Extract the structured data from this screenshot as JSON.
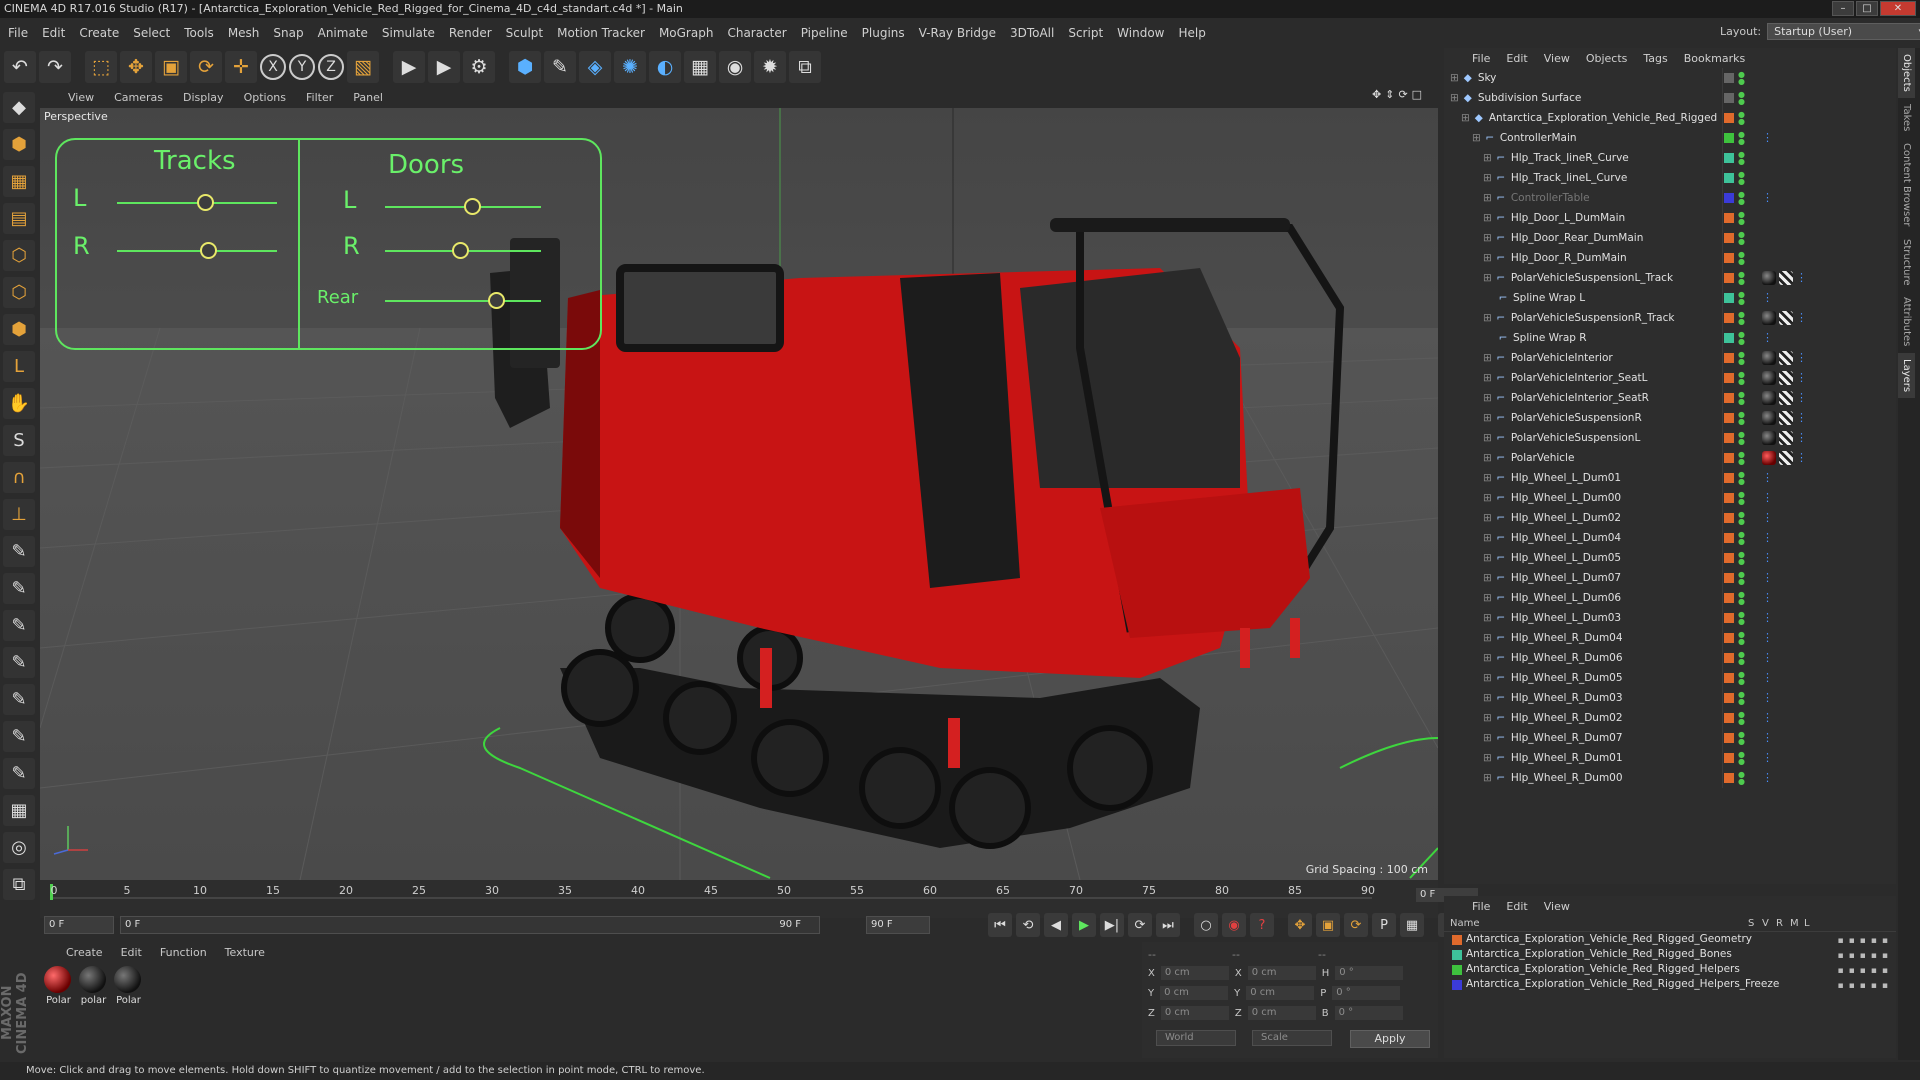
{
  "window": {
    "title": "CINEMA 4D R17.016 Studio (R17) - [Antarctica_Exploration_Vehicle_Red_Rigged_for_Cinema_4D_c4d_standart.c4d *] - Main"
  },
  "menubar": {
    "items": [
      "File",
      "Edit",
      "Create",
      "Select",
      "Tools",
      "Mesh",
      "Snap",
      "Animate",
      "Simulate",
      "Render",
      "Sculpt",
      "Motion Tracker",
      "MoGraph",
      "Character",
      "Pipeline",
      "Plugins",
      "V-Ray Bridge",
      "3DToAll",
      "Script",
      "Window",
      "Help"
    ],
    "layout_label": "Layout:",
    "layout_value": "Startup (User)"
  },
  "toolbar": {
    "icons": [
      "undo-icon",
      "redo-icon",
      "live-selection-icon",
      "move-icon",
      "scale-icon",
      "rotate-icon",
      "world-axis-icon",
      "x-axis-icon",
      "y-axis-icon",
      "z-axis-icon",
      "coordinate-system-icon",
      "render-view-icon",
      "render-picture-viewer-icon",
      "render-settings-icon",
      "cube-icon",
      "pen-icon",
      "subdivision-icon",
      "array-icon",
      "deformer-icon",
      "floor-icon",
      "camera-icon",
      "light-icon",
      "python-icon"
    ],
    "axis_labels": [
      "X",
      "Y",
      "Z"
    ]
  },
  "viewport": {
    "menu": [
      "View",
      "Cameras",
      "Display",
      "Options",
      "Filter",
      "Panel"
    ],
    "label": "Perspective",
    "grid_spacing": "Grid Spacing : 100 cm",
    "hud": {
      "tracks_title": "Tracks",
      "doors_title": "Doors",
      "label_l": "L",
      "label_r": "R",
      "label_rear": "Rear"
    }
  },
  "timeline": {
    "ticks": [
      "0",
      "5",
      "10",
      "15",
      "20",
      "25",
      "30",
      "35",
      "40",
      "45",
      "50",
      "55",
      "60",
      "65",
      "70",
      "75",
      "80",
      "85",
      "90"
    ],
    "current_frame": "0 F"
  },
  "playback": {
    "start": "0 F",
    "range_start": "0 F",
    "range_end": "90 F",
    "end": "90 F"
  },
  "material_manager": {
    "menu": [
      "Create",
      "Edit",
      "Function",
      "Texture"
    ],
    "materials": [
      {
        "label": "Polar",
        "style": "red"
      },
      {
        "label": "polar",
        "style": "dark"
      },
      {
        "label": "Polar",
        "style": "dark"
      }
    ]
  },
  "coordinates": {
    "header_left": "--",
    "header_mid": "--",
    "header_right": "--",
    "rows": [
      {
        "a": "X",
        "av": "0 cm",
        "b": "X",
        "bv": "0 cm",
        "c": "H",
        "cv": "0 °"
      },
      {
        "a": "Y",
        "av": "0 cm",
        "b": "Y",
        "bv": "0 cm",
        "c": "P",
        "cv": "0 °"
      },
      {
        "a": "Z",
        "av": "0 cm",
        "b": "Z",
        "bv": "0 cm",
        "c": "B",
        "cv": "0 °"
      }
    ],
    "mode_world": "World",
    "mode_scale": "Scale",
    "apply": "Apply"
  },
  "maxon_logo": "MAXON CINEMA 4D",
  "status": "Move: Click and drag to move elements. Hold down SHIFT to quantize movement / add to the selection in point mode, CTRL to remove.",
  "object_manager": {
    "menu": [
      "File",
      "Edit",
      "View",
      "Objects",
      "Tags",
      "Bookmarks"
    ],
    "objects": [
      {
        "name": "Sky",
        "indent": 0,
        "flag": "#666666",
        "tags": []
      },
      {
        "name": "Subdivision Surface",
        "indent": 0,
        "flag": "#666666",
        "tags": []
      },
      {
        "name": "Antarctica_Exploration_Vehicle_Red_Rigged",
        "indent": 1,
        "flag": "#e06a2c",
        "tags": []
      },
      {
        "name": "ControllerMain",
        "indent": 2,
        "flag": "#3ec23e",
        "tags": [
          "ik"
        ]
      },
      {
        "name": "Hlp_Track_lineR_Curve",
        "indent": 3,
        "flag": "#3ec29a",
        "tags": []
      },
      {
        "name": "Hlp_Track_lineL_Curve",
        "indent": 3,
        "flag": "#3ec29a",
        "tags": []
      },
      {
        "name": "ControllerTable",
        "indent": 3,
        "flag": "#3b3bd8",
        "tags": [
          "ik"
        ],
        "dim": true
      },
      {
        "name": "Hlp_Door_L_DumMain",
        "indent": 3,
        "flag": "#e06a2c",
        "tags": []
      },
      {
        "name": "Hlp_Door_Rear_DumMain",
        "indent": 3,
        "flag": "#e06a2c",
        "tags": []
      },
      {
        "name": "Hlp_Door_R_DumMain",
        "indent": 3,
        "flag": "#e06a2c",
        "tags": []
      },
      {
        "name": "PolarVehicleSuspensionL_Track",
        "indent": 3,
        "flag": "#e06a2c",
        "tags": [
          "dark",
          "chk",
          "ik"
        ]
      },
      {
        "name": "Spline Wrap L",
        "indent": 4,
        "flag": "#3ec29a",
        "tags": [
          "ik"
        ]
      },
      {
        "name": "PolarVehicleSuspensionR_Track",
        "indent": 3,
        "flag": "#e06a2c",
        "tags": [
          "dark",
          "chk",
          "ik"
        ]
      },
      {
        "name": "Spline Wrap R",
        "indent": 4,
        "flag": "#3ec29a",
        "tags": [
          "ik"
        ]
      },
      {
        "name": "PolarVehicleInterior",
        "indent": 3,
        "flag": "#e06a2c",
        "tags": [
          "dark",
          "chk",
          "ik"
        ]
      },
      {
        "name": "PolarVehicleInterior_SeatL",
        "indent": 3,
        "flag": "#e06a2c",
        "tags": [
          "dark",
          "chk",
          "ik"
        ]
      },
      {
        "name": "PolarVehicleInterior_SeatR",
        "indent": 3,
        "flag": "#e06a2c",
        "tags": [
          "dark",
          "chk",
          "ik"
        ]
      },
      {
        "name": "PolarVehicleSuspensionR",
        "indent": 3,
        "flag": "#e06a2c",
        "tags": [
          "dark",
          "chk",
          "ik"
        ]
      },
      {
        "name": "PolarVehicleSuspensionL",
        "indent": 3,
        "flag": "#e06a2c",
        "tags": [
          "dark",
          "chk",
          "ik"
        ]
      },
      {
        "name": "PolarVehicle",
        "indent": 3,
        "flag": "#e06a2c",
        "tags": [
          "redball",
          "chk",
          "ik"
        ]
      },
      {
        "name": "Hlp_Wheel_L_Dum01",
        "indent": 3,
        "flag": "#e06a2c",
        "tags": [
          "ik"
        ]
      },
      {
        "name": "Hlp_Wheel_L_Dum00",
        "indent": 3,
        "flag": "#e06a2c",
        "tags": [
          "ik"
        ]
      },
      {
        "name": "Hlp_Wheel_L_Dum02",
        "indent": 3,
        "flag": "#e06a2c",
        "tags": [
          "ik"
        ]
      },
      {
        "name": "Hlp_Wheel_L_Dum04",
        "indent": 3,
        "flag": "#e06a2c",
        "tags": [
          "ik"
        ]
      },
      {
        "name": "Hlp_Wheel_L_Dum05",
        "indent": 3,
        "flag": "#e06a2c",
        "tags": [
          "ik"
        ]
      },
      {
        "name": "Hlp_Wheel_L_Dum07",
        "indent": 3,
        "flag": "#e06a2c",
        "tags": [
          "ik"
        ]
      },
      {
        "name": "Hlp_Wheel_L_Dum06",
        "indent": 3,
        "flag": "#e06a2c",
        "tags": [
          "ik"
        ]
      },
      {
        "name": "Hlp_Wheel_L_Dum03",
        "indent": 3,
        "flag": "#e06a2c",
        "tags": [
          "ik"
        ]
      },
      {
        "name": "Hlp_Wheel_R_Dum04",
        "indent": 3,
        "flag": "#e06a2c",
        "tags": [
          "ik"
        ]
      },
      {
        "name": "Hlp_Wheel_R_Dum06",
        "indent": 3,
        "flag": "#e06a2c",
        "tags": [
          "ik"
        ]
      },
      {
        "name": "Hlp_Wheel_R_Dum05",
        "indent": 3,
        "flag": "#e06a2c",
        "tags": [
          "ik"
        ]
      },
      {
        "name": "Hlp_Wheel_R_Dum03",
        "indent": 3,
        "flag": "#e06a2c",
        "tags": [
          "ik"
        ]
      },
      {
        "name": "Hlp_Wheel_R_Dum02",
        "indent": 3,
        "flag": "#e06a2c",
        "tags": [
          "ik"
        ]
      },
      {
        "name": "Hlp_Wheel_R_Dum07",
        "indent": 3,
        "flag": "#e06a2c",
        "tags": [
          "ik"
        ]
      },
      {
        "name": "Hlp_Wheel_R_Dum01",
        "indent": 3,
        "flag": "#e06a2c",
        "tags": [
          "ik"
        ]
      },
      {
        "name": "Hlp_Wheel_R_Dum00",
        "indent": 3,
        "flag": "#e06a2c",
        "tags": [
          "ik"
        ]
      }
    ]
  },
  "layer_manager": {
    "menu": [
      "File",
      "Edit",
      "View"
    ],
    "columns": [
      "Name",
      "S",
      "V",
      "R",
      "M",
      "L"
    ],
    "layers": [
      {
        "name": "Antarctica_Exploration_Vehicle_Red_Rigged_Geometry",
        "color": "#e06a2c"
      },
      {
        "name": "Antarctica_Exploration_Vehicle_Red_Rigged_Bones",
        "color": "#3ec29a"
      },
      {
        "name": "Antarctica_Exploration_Vehicle_Red_Rigged_Helpers",
        "color": "#3ec23e"
      },
      {
        "name": "Antarctica_Exploration_Vehicle_Red_Rigged_Helpers_Freeze",
        "color": "#3b3bd8"
      }
    ]
  },
  "right_tabs": [
    "Objects",
    "Takes",
    "Content Browser",
    "Structure",
    "Attributes",
    "Layers"
  ]
}
